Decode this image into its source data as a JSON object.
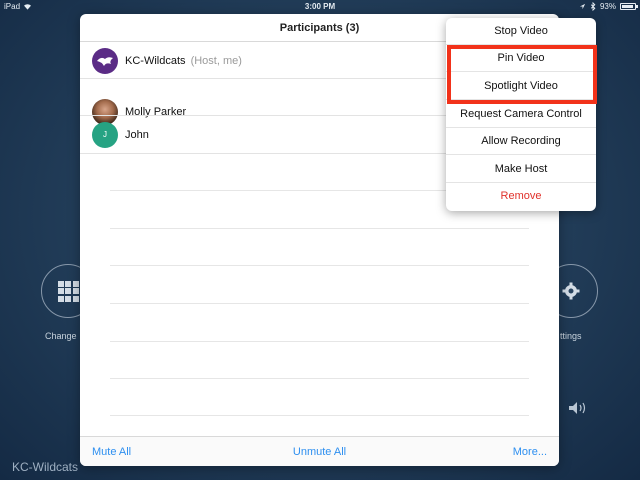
{
  "status_bar": {
    "device": "iPad",
    "time": "3:00 PM",
    "battery": "93%"
  },
  "background": {
    "left_control_label": "Change",
    "right_control_label": "ttings",
    "meeting_name": "KC-Wildcats"
  },
  "participants": {
    "title": "Participants (3)",
    "rows": [
      {
        "name": "KC-Wildcats",
        "role": "(Host, me)",
        "avatar": "wildcat-logo"
      },
      {
        "name": "Molly Parker",
        "role": "",
        "avatar": "photo"
      },
      {
        "name": "John",
        "role": "",
        "avatar_initial": "J"
      }
    ],
    "footer": {
      "mute_all": "Mute All",
      "unmute_all": "Unmute All",
      "more": "More..."
    }
  },
  "context_menu": {
    "items": [
      "Stop Video",
      "Pin Video",
      "Spotlight Video",
      "Request Camera Control",
      "Allow Recording",
      "Make Host",
      "Remove"
    ],
    "danger_color": "#e0312b",
    "highlight_color": "#f2321a"
  },
  "colors": {
    "accent": "#2d8ff0",
    "john_avatar": "#26a383",
    "wildcat_avatar": "#5b2c86"
  }
}
